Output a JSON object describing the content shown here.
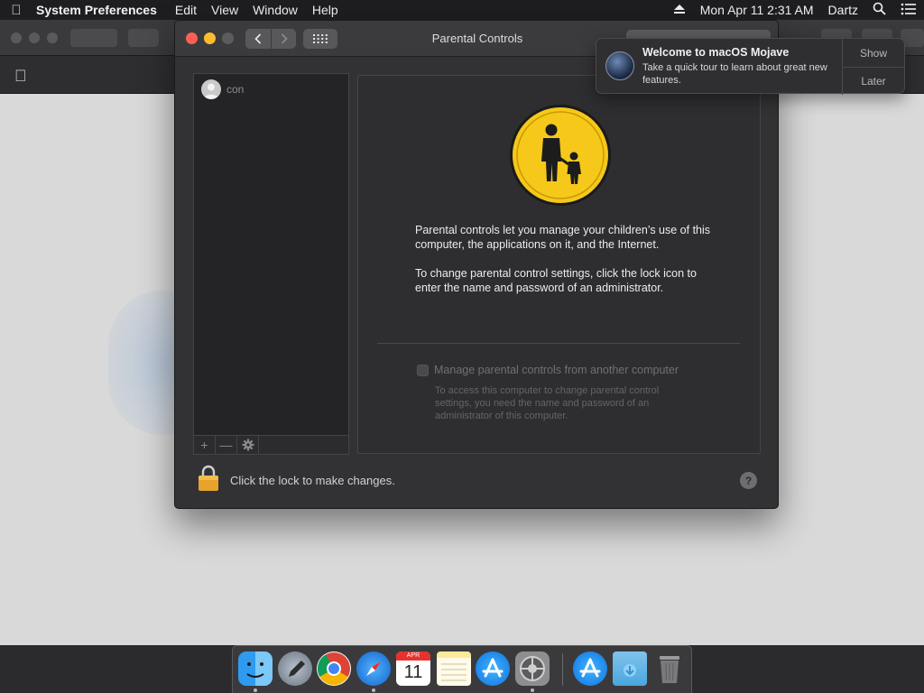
{
  "menubar": {
    "app_name": "System Preferences",
    "items": [
      "Edit",
      "View",
      "Window",
      "Help"
    ],
    "datetime": "Mon Apr 11  2:31 AM",
    "user": "Dartz"
  },
  "window": {
    "title": "Parental Controls"
  },
  "sidebar": {
    "user_name": "con",
    "add_label": "+",
    "remove_label": "—"
  },
  "content": {
    "para1": "Parental controls let you manage your children’s use of this computer, the applications on it, and the Internet.",
    "para2": "To change parental control settings, click the lock icon to enter the name and password of an administrator.",
    "remote_checkbox_label": "Manage parental controls from another computer",
    "remote_help": "To access this computer to change parental control settings, you need the name and password of an administrator of this computer."
  },
  "footer": {
    "lock_text": "Click the lock to make changes.",
    "help_label": "?"
  },
  "notification": {
    "title": "Welcome to macOS Mojave",
    "body": "Take a quick tour to learn about great new features.",
    "show_label": "Show",
    "later_label": "Later"
  },
  "calendar": {
    "month": "APR",
    "day": "11"
  },
  "colors": {
    "close": "#fd5f57",
    "minimize": "#febc2e",
    "icon_yellow": "#f5c81a"
  }
}
